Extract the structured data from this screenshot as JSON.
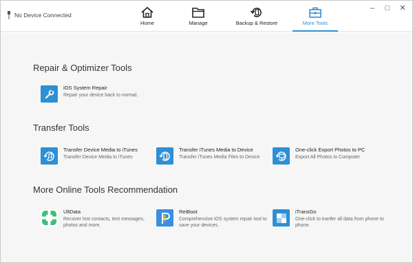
{
  "device": {
    "status": "No Device Connected"
  },
  "nav": [
    {
      "label": "Home",
      "icon": "home-icon"
    },
    {
      "label": "Manage",
      "icon": "folder-icon"
    },
    {
      "label": "Backup & Restore",
      "icon": "backup-restore-icon"
    },
    {
      "label": "More Tools",
      "icon": "toolbox-icon",
      "active": true
    }
  ],
  "window_controls": [
    "minimize",
    "maximize",
    "close"
  ],
  "accent_color": "#2f8fd4",
  "sections": [
    {
      "title": "Repair & Optimizer Tools",
      "tools": [
        {
          "name": "iOS System Repair",
          "desc": "Repair your device back to normal.",
          "icon": "wrench-icon"
        }
      ]
    },
    {
      "title": "Transfer Tools",
      "tools": [
        {
          "name": "Transfer Device Media to iTunes",
          "desc": "Transfer Device Media to iTunes",
          "icon": "music-transfer-icon"
        },
        {
          "name": "Transfer iTunes Media to Device",
          "desc": "Transfer iTunes Media Files to Device",
          "icon": "device-transfer-icon"
        },
        {
          "name": "One-click Export Photos to PC",
          "desc": "Export All Photos to Computer",
          "icon": "export-photos-icon"
        }
      ]
    },
    {
      "title": "More Online Tools Recommendation",
      "tools": [
        {
          "name": "UltData",
          "desc": "Recover lost contacts, text messages, photos and more.",
          "icon": "ultdata-logo-icon"
        },
        {
          "name": "ReiBoot",
          "desc": "Comprehensive iOS system repair tool to save your devices.",
          "icon": "reiboot-logo-icon"
        },
        {
          "name": "iTransGo",
          "desc": "One-click to tranfer all data from phone to phone.",
          "icon": "itransgo-logo-icon"
        }
      ]
    }
  ]
}
